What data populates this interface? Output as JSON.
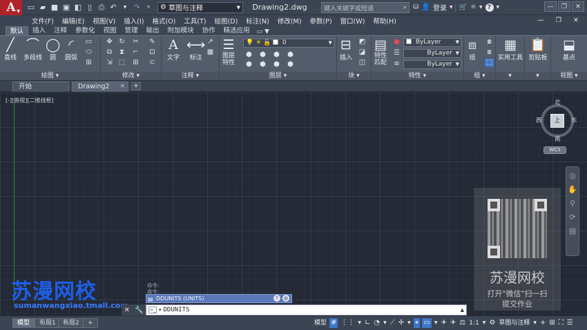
{
  "app": {
    "logo_letter": "A",
    "doc_title": "Drawing2.dwg",
    "workspace": "草图与注释",
    "search_placeholder": "键入关键字或短语",
    "login_label": "登录"
  },
  "menu": [
    "文件(F)",
    "编辑(E)",
    "视图(V)",
    "插入(I)",
    "格式(O)",
    "工具(T)",
    "绘图(D)",
    "标注(N)",
    "修改(M)",
    "参数(P)",
    "窗口(W)",
    "帮助(H)"
  ],
  "ribbon_tabs": [
    "默认",
    "插入",
    "注释",
    "参数化",
    "视图",
    "管理",
    "输出",
    "附加模块",
    "协作",
    "精选应用"
  ],
  "ribbon": {
    "draw": {
      "title": "绘图",
      "line": "直线",
      "polyline": "多段线",
      "circle": "圆",
      "arc": "圆弧"
    },
    "modify": {
      "title": "修改"
    },
    "annotation": {
      "title": "注释",
      "text": "文字",
      "dimension": "标注"
    },
    "layers": {
      "title": "图层",
      "layer_props": "图层\n特性",
      "current_layer": "0"
    },
    "block": {
      "title": "块",
      "insert": "插入"
    },
    "properties": {
      "title": "特性",
      "match": "特性\n匹配",
      "color": "ByLayer",
      "linetype": "ByLayer",
      "lineweight": "ByLayer"
    },
    "groups": {
      "title": "组",
      "group": "组"
    },
    "utilities": {
      "label": "实用工具"
    },
    "clipboard": {
      "label": "剪贴板"
    },
    "base": {
      "label": "基点"
    },
    "view": {
      "title": "视图"
    }
  },
  "doc_tabs": [
    {
      "label": "开始"
    },
    {
      "label": "Drawing2",
      "close": "×"
    }
  ],
  "doc_tab_add": "+",
  "canvas": {
    "viewport_label": "[-][俯视][二维线框]",
    "viewcube": {
      "north": "北",
      "south": "南",
      "east": "东",
      "west": "西",
      "face": "上",
      "wcs": "WCS"
    }
  },
  "watermark": {
    "brand": "苏漫网校",
    "url": "sumanwangxiao.tmall.com",
    "panel_brand": "苏漫网校",
    "panel_line1": "打开\"微信\"扫一扫",
    "panel_line2": "提交作业"
  },
  "command": {
    "history": [
      "命令:",
      "命令:"
    ],
    "popup_text": "DDUNITS (UNITS)",
    "input_value": "DDUNITS",
    "prompt_icon": ">_"
  },
  "layout_tabs": [
    "模型",
    "布局1",
    "布局2"
  ],
  "layout_add": "+",
  "status": {
    "model": "模型",
    "scale": "1:1",
    "workspace": "草图与注释"
  }
}
